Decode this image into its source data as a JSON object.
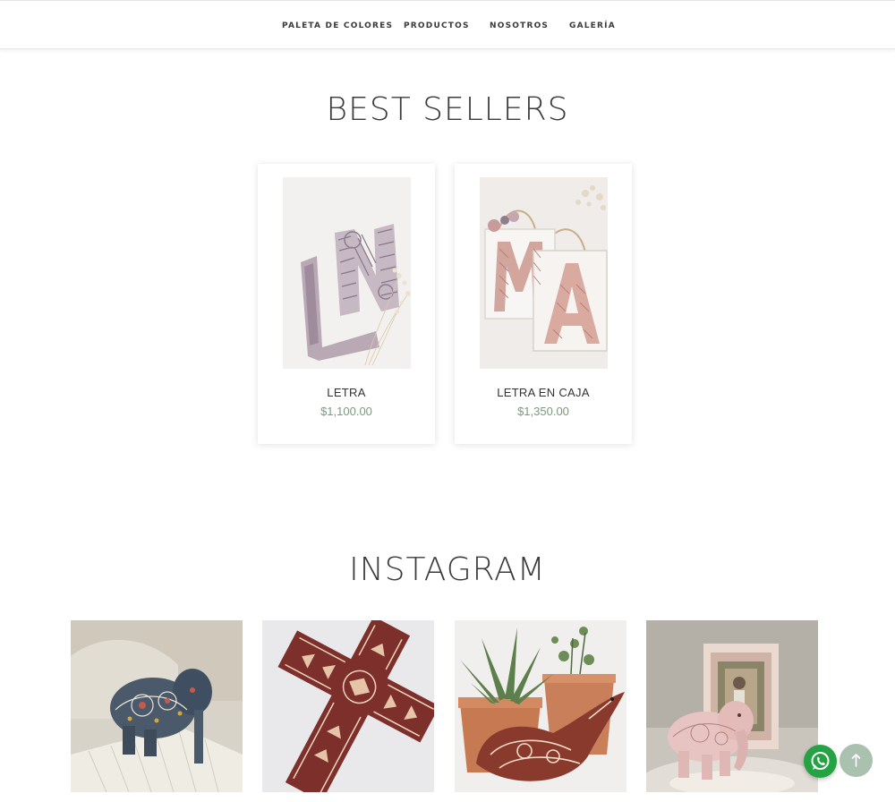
{
  "nav": {
    "items": [
      {
        "label": "PALETA DE COLORES"
      },
      {
        "label": "PRODUCTOS"
      },
      {
        "label": "NOSOTROS"
      },
      {
        "label": "GALERÍA"
      }
    ]
  },
  "best_sellers": {
    "title": "BEST SELLERS",
    "products": [
      {
        "name": "LETRA",
        "price": "$1,100.00",
        "image_icon": "letter-n-l-huichol-image"
      },
      {
        "name": "LETRA EN CAJA",
        "price": "$1,350.00",
        "image_icon": "letter-m-a-frame-image"
      }
    ]
  },
  "instagram": {
    "title": "INSTAGRAM",
    "posts": [
      {
        "image_icon": "beaded-elephant-image"
      },
      {
        "image_icon": "beaded-cross-image"
      },
      {
        "image_icon": "beaded-bird-plant-image"
      },
      {
        "image_icon": "pink-elephant-frame-image"
      }
    ]
  },
  "floating": {
    "whatsapp_icon": "whatsapp-icon",
    "scroll_top_icon": "arrow-up-icon"
  },
  "colors": {
    "price": "#7a9a7e",
    "whatsapp": "#25a244",
    "scroll_top": "#a9c1ae"
  }
}
